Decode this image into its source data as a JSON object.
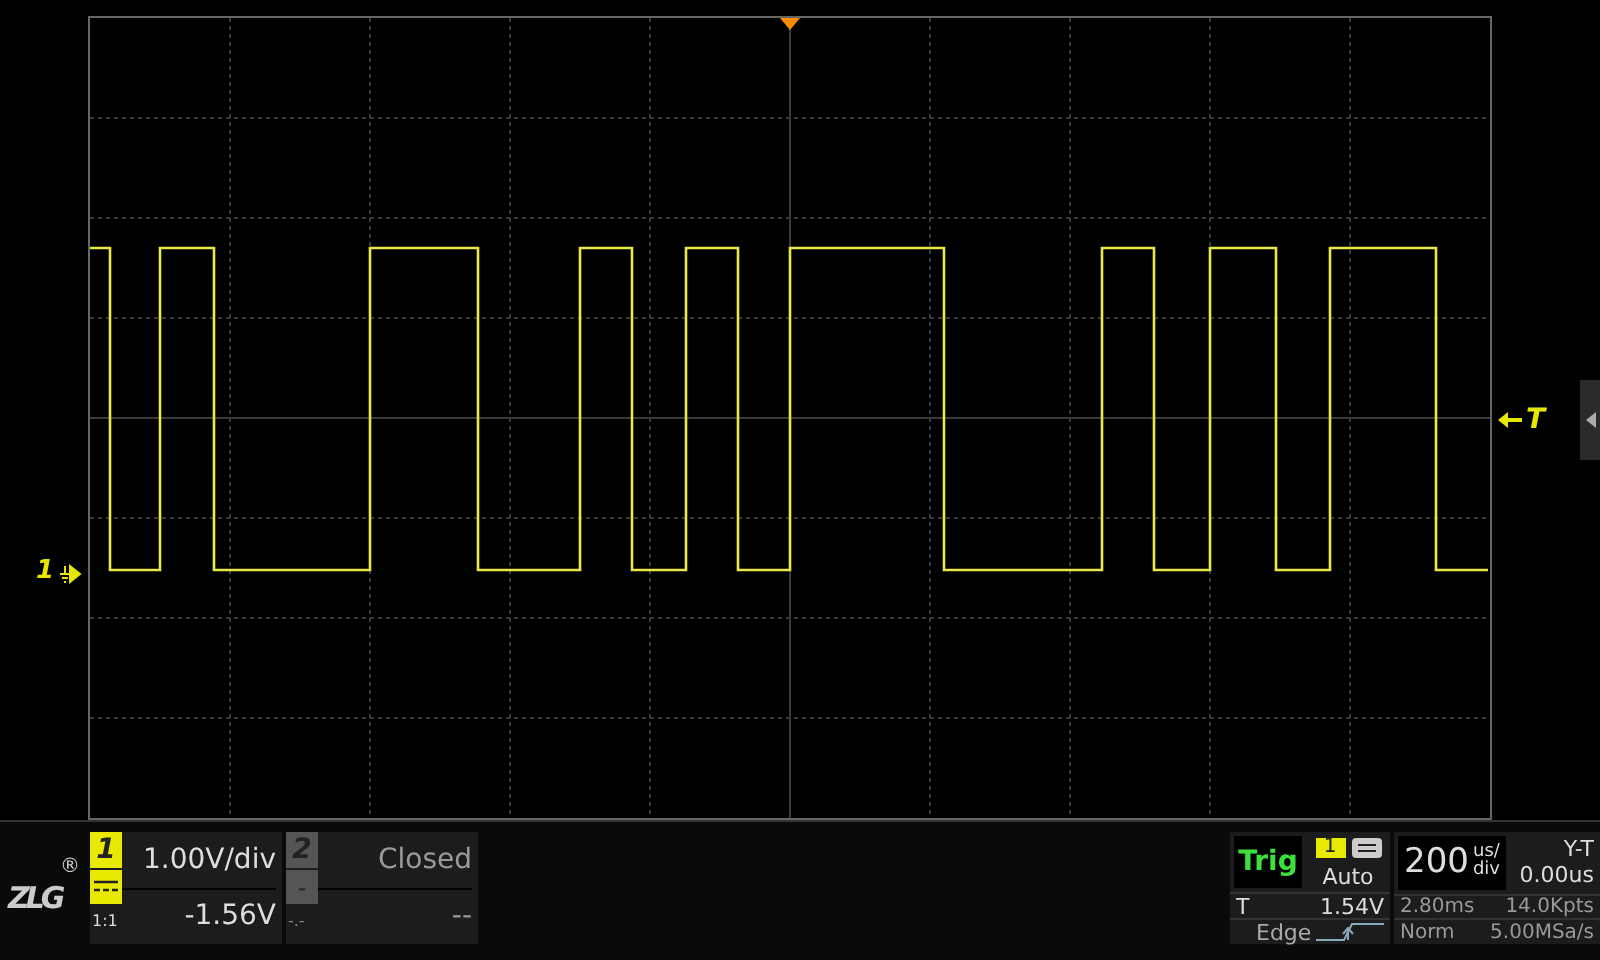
{
  "channel_marker": {
    "label": "1"
  },
  "trigger_marker": {
    "label": "T"
  },
  "logo": {
    "text": "ZLG",
    "mark": "®"
  },
  "channels": [
    {
      "number": "1",
      "enabled": true,
      "scale": "1.00V/div",
      "offset": "-1.56V",
      "probe": "1:1"
    },
    {
      "number": "2",
      "enabled": false,
      "status": "Closed",
      "offset": "--",
      "coupling": "-",
      "probe": "-.-"
    }
  ],
  "trigger": {
    "label": "Trig",
    "source": "1",
    "mode": "Auto",
    "level_label": "T",
    "level": "1.54V",
    "type": "Edge"
  },
  "timebase": {
    "value": "200",
    "unit_top": "us/",
    "unit_bottom": "div",
    "mode": "Y-T",
    "delay": "0.00us",
    "duration": "2.80ms",
    "points": "14.0Kpts",
    "acquire": "Norm",
    "rate": "5.00MSa/s"
  }
}
